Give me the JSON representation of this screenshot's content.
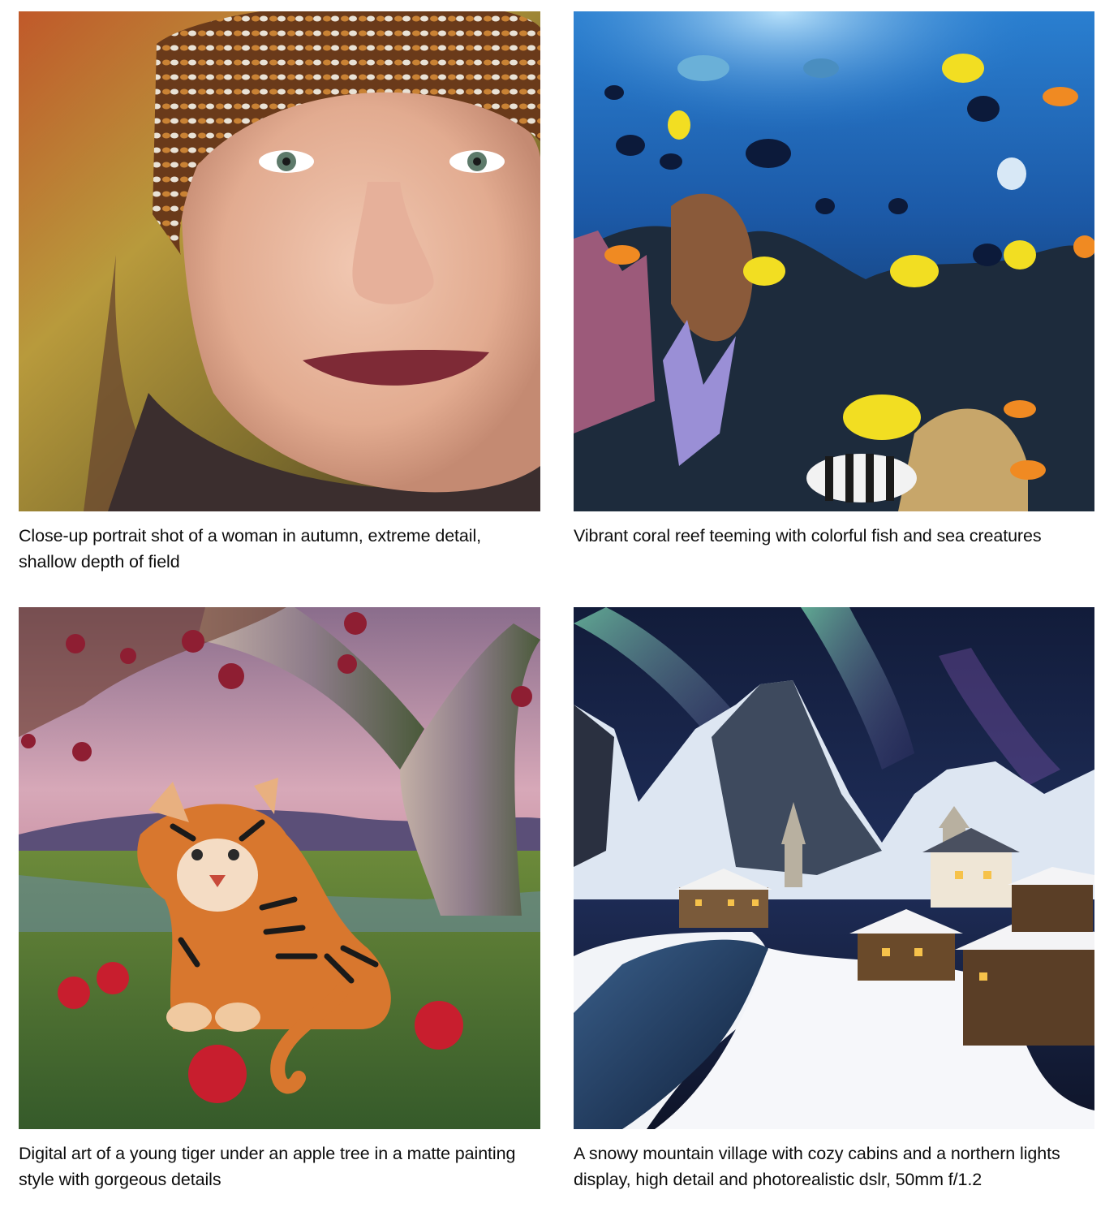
{
  "gallery": {
    "items": [
      {
        "image_alt": "woman in knit hat autumn portrait",
        "caption": "Close-up portrait shot of a woman in autumn, extreme detail, shallow depth of field"
      },
      {
        "image_alt": "coral reef with tropical fish",
        "caption": "Vibrant coral reef teeming with colorful fish and sea creatures"
      },
      {
        "image_alt": "young tiger under apple tree",
        "caption": "Digital art of a young tiger under an apple tree in a matte painting style with gorgeous details"
      },
      {
        "image_alt": "snowy mountain village with northern lights",
        "caption": "A snowy mountain village with cozy cabins and a northern lights display, high detail and photorealistic dslr, 50mm f/1.2"
      }
    ]
  }
}
